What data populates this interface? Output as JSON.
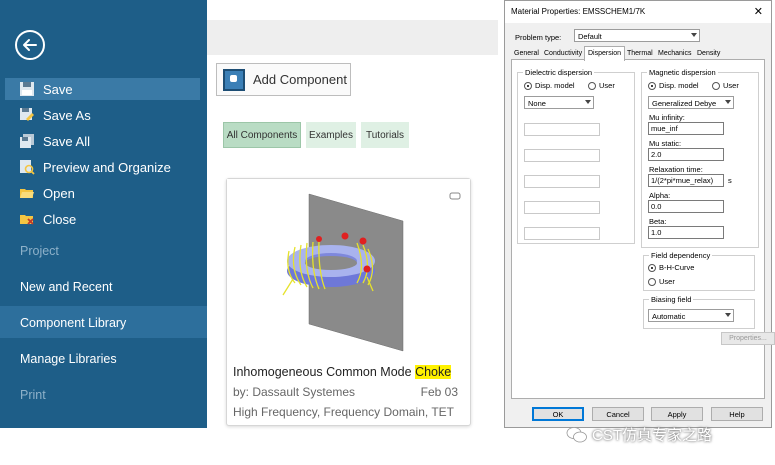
{
  "sidebar": {
    "menu": [
      {
        "label": "Save",
        "icon": "save-icon"
      },
      {
        "label": "Save As",
        "icon": "save-as-icon"
      },
      {
        "label": "Save All",
        "icon": "save-all-icon"
      },
      {
        "label": "Preview and Organize",
        "icon": "preview-icon"
      },
      {
        "label": "Open",
        "icon": "open-folder-icon"
      },
      {
        "label": "Close",
        "icon": "close-folder-icon"
      }
    ],
    "sections": {
      "project": "Project",
      "new_recent": "New and Recent",
      "component_library": "Component Library",
      "manage_libraries": "Manage Libraries",
      "print": "Print"
    }
  },
  "main": {
    "add_component": "Add Component",
    "filters": [
      "All Components",
      "Examples",
      "Tutorials"
    ],
    "card": {
      "title_prefix": "Inhomogeneous Common Mode ",
      "title_highlight": "Choke",
      "author": "by: Dassault Systemes",
      "date": "Feb 03",
      "tags": "High Frequency, Frequency Domain, TET"
    }
  },
  "dialog": {
    "title": "Material Properties: EMSSCHEM1/7K",
    "close": "✕",
    "problem_type_label": "Problem type:",
    "problem_type_value": "Default",
    "tabs": [
      "General",
      "Conductivity",
      "Dispersion",
      "Thermal",
      "Mechanics",
      "Density"
    ],
    "dielectric": {
      "title": "Dielectric dispersion",
      "radio_model": "Disp. model",
      "radio_user": "User",
      "model_value": "None"
    },
    "magnetic": {
      "title": "Magnetic dispersion",
      "radio_model": "Disp. model",
      "radio_user": "User",
      "model_value": "Generalized Debye",
      "mu_inf_label": "Mu infinity:",
      "mu_inf_value": "mue_inf",
      "mu_static_label": "Mu static:",
      "mu_static_value": "2.0",
      "relax_label": "Relaxation time:",
      "relax_value": "1/(2*pi*mue_relax)",
      "relax_unit": "s",
      "alpha_label": "Alpha:",
      "alpha_value": "0.0",
      "beta_label": "Beta:",
      "beta_value": "1.0"
    },
    "field_dependency": {
      "title": "Field dependency",
      "bh": "B-H-Curve",
      "user": "User",
      "properties": "Properties..."
    },
    "biasing": {
      "title": "Biasing field",
      "value": "Automatic"
    },
    "buttons": {
      "ok": "OK",
      "cancel": "Cancel",
      "apply": "Apply",
      "help": "Help"
    }
  },
  "watermark": "CST仿真专家之路",
  "colors": {
    "sidebar": "#1e5e88",
    "filter_selected": "#b9dcc4",
    "filter": "#dff0e4",
    "highlight": "#fff200"
  }
}
